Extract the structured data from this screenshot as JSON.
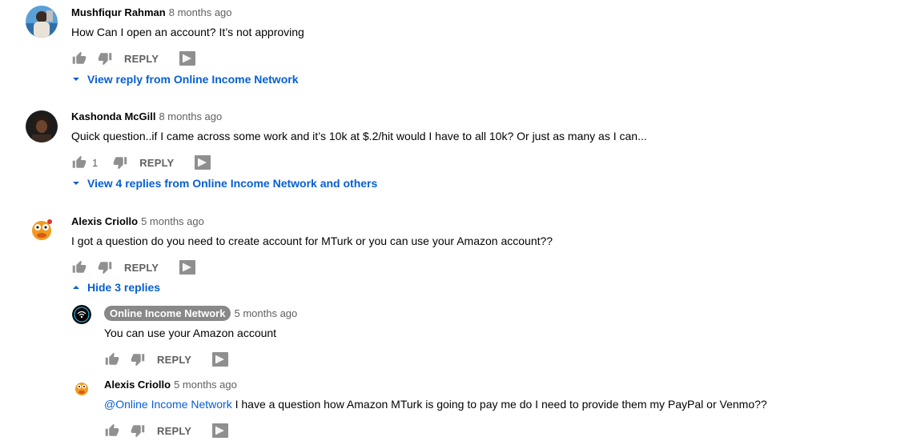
{
  "comments": [
    {
      "author": "Mushfiqur Rahman",
      "time": "8 months ago",
      "text": "How Can I open an account? It’s not approving",
      "likes": "",
      "reply_label": "REPLY",
      "toggle_label": "View reply from Online Income Network"
    },
    {
      "author": "Kashonda McGill",
      "time": "8 months ago",
      "text": "Quick question..if I came across some work and it’s 10k at $.2/hit would I have to all 10k? Or just as many as I can...",
      "likes": "1",
      "reply_label": "REPLY",
      "toggle_label": "View 4 replies from Online Income Network and others"
    },
    {
      "author": "Alexis Criollo",
      "time": "5 months ago",
      "text": "I got a question do you need to create account for MTurk or you can use your Amazon account??",
      "likes": "",
      "reply_label": "REPLY",
      "toggle_label": "Hide 3 replies",
      "replies": [
        {
          "author": "Online Income Network",
          "author_is_creator": true,
          "time": "5 months ago",
          "text": "You can use your Amazon account",
          "reply_label": "REPLY"
        },
        {
          "author": "Alexis Criollo",
          "time": "5 months ago",
          "mention": "@Online Income Network",
          "text": " I have a question how Amazon MTurk is going to pay me do I need to provide them my PayPal or Venmo??",
          "reply_label": "REPLY"
        }
      ]
    }
  ],
  "icons": {
    "like": "thumbs-up-icon",
    "dislike": "thumbs-down-icon",
    "flag": "flag-icon",
    "expand": "chevron-down-icon",
    "collapse": "chevron-up-icon"
  },
  "colors": {
    "link": "#065fd4",
    "meta": "#606060",
    "creator_badge": "#888888"
  }
}
